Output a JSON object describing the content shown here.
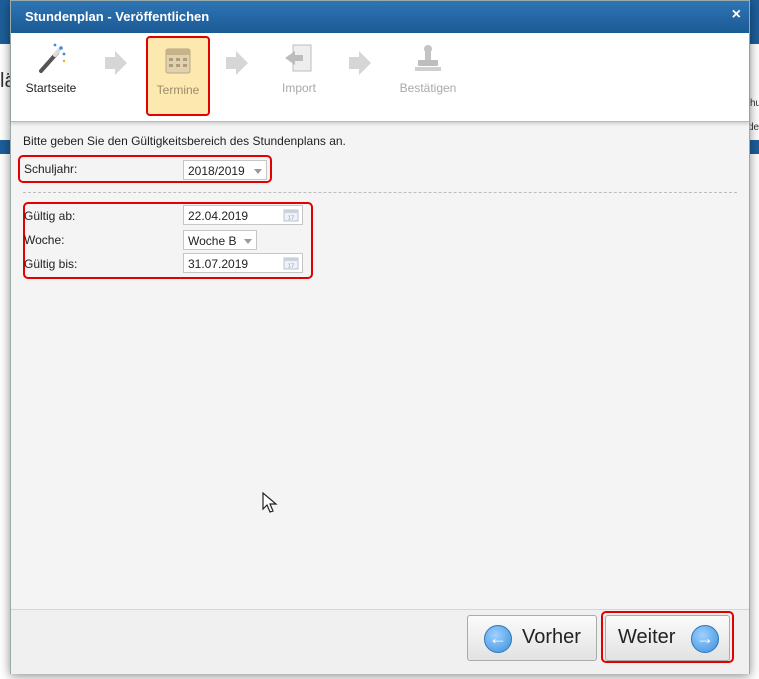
{
  "dialog": {
    "title": "Stundenplan - Veröffentlichen",
    "close_symbol": "×"
  },
  "background": {
    "peek_left": "lä",
    "peek_right_1": "hu",
    "peek_right_2": "de"
  },
  "wizard": {
    "steps": [
      {
        "label": "Startseite",
        "state": "done",
        "icon": "magic-wand-icon"
      },
      {
        "label": "Termine",
        "state": "active",
        "icon": "calendar-icon"
      },
      {
        "label": "Import",
        "state": "future",
        "icon": "import-icon"
      },
      {
        "label": "Bestätigen",
        "state": "future",
        "icon": "stamp-icon"
      }
    ]
  },
  "form": {
    "instruction": "Bitte geben Sie den Gültigkeitsbereich des Stundenplans an.",
    "schuljahr": {
      "label": "Schuljahr:",
      "value": "2018/2019"
    },
    "gueltig_ab": {
      "label": "Gültig ab:",
      "value": "22.04.2019"
    },
    "woche": {
      "label": "Woche:",
      "value": "Woche B"
    },
    "gueltig_bis": {
      "label": "Gültig bis:",
      "value": "31.07.2019"
    }
  },
  "buttons": {
    "prev": {
      "label": "Vorher",
      "icon": "arrow-left-icon",
      "glyph": "←"
    },
    "next": {
      "label": "Weiter",
      "icon": "arrow-right-icon",
      "glyph": "→"
    }
  },
  "colors": {
    "title_bar": "#1d5f9b",
    "highlight": "#e20000",
    "active_step_bg": "#fde9b0"
  }
}
